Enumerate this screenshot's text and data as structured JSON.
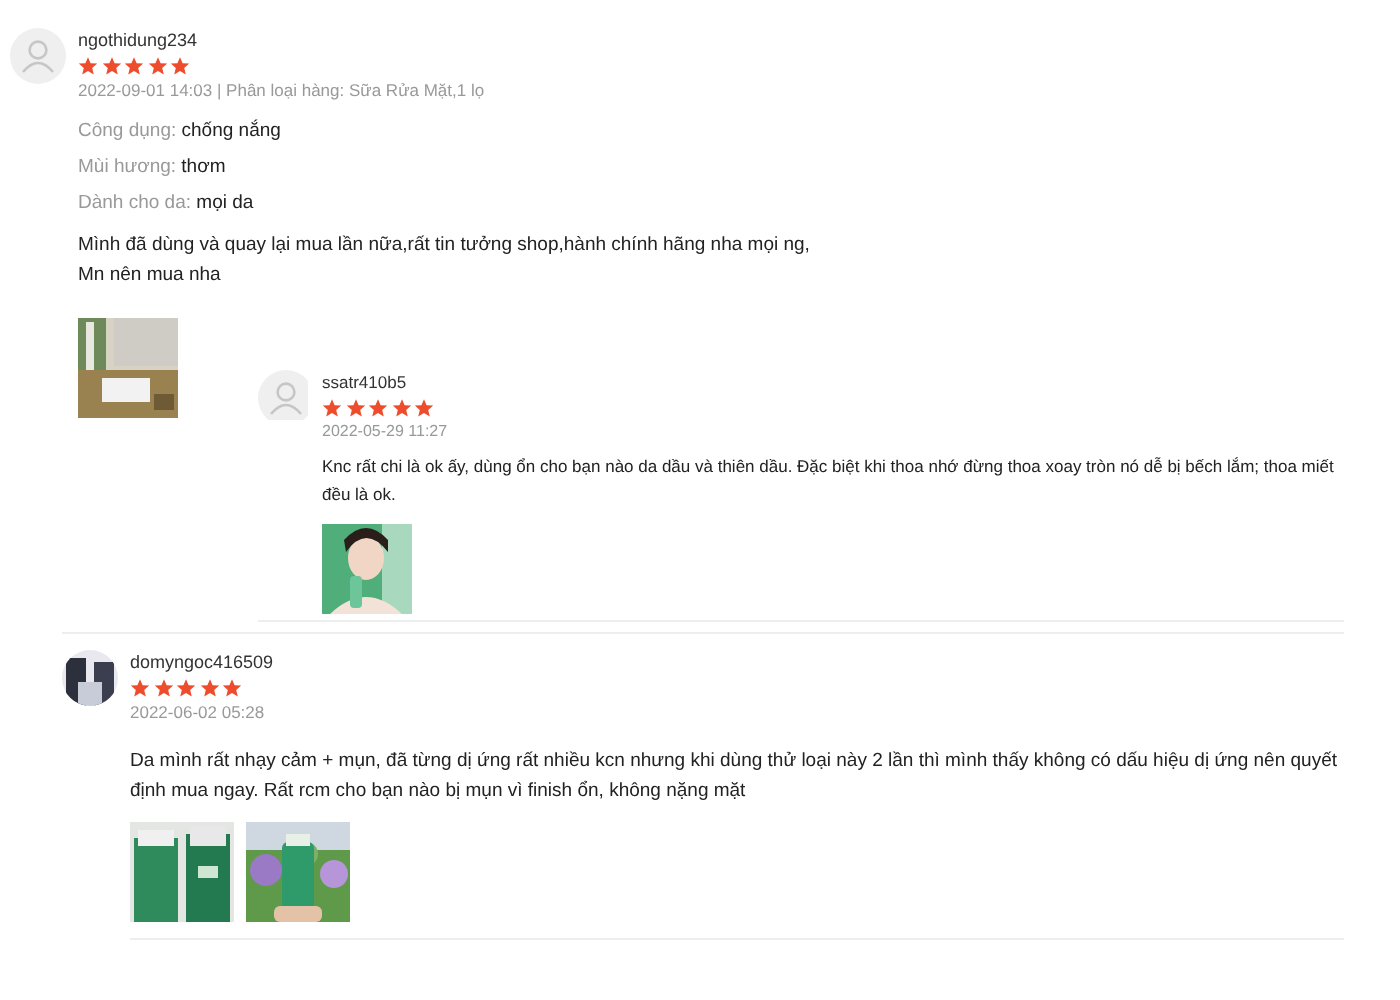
{
  "reviews": [
    {
      "user": "ngothidung234",
      "stars": 5,
      "meta": "2022-09-01 14:03 | Phân loại hàng: Sữa Rửa Mặt,1 lọ",
      "attributes": [
        {
          "label": "Công dụng:",
          "value": "chống nắng"
        },
        {
          "label": "Mùi hương:",
          "value": "thơm"
        },
        {
          "label": "Dành cho da:",
          "value": "mọi da"
        }
      ],
      "body": "Mình đã dùng và quay lại mua lần nữa,rất tin tưởng shop,hành chính hãng nha mọi ng,\nMn nên mua nha",
      "photos": [
        {
          "kind": "picture"
        }
      ],
      "children": [
        {
          "user": "ssatr410b5",
          "stars": 5,
          "meta": "2022-05-29 11:27",
          "body": "Knc rất chi là ok ấy, dùng ổn cho bạn nào da dầu và thiên dầu. Đặc biệt khi thoa nhớ đừng thoa xoay tròn nó dễ bị bếch lắm; thoa miết đều là ok.",
          "photos": [
            {
              "kind": "picture"
            }
          ]
        }
      ]
    },
    {
      "user": "domyngoc416509",
      "avatar": {
        "kind": "picture"
      },
      "stars": 5,
      "meta": "2022-06-02 05:28",
      "body": "Da mình rất nhạy cảm + mụn, đã từng dị ứng rất nhiều kcn nhưng khi dùng thử loại này 2 lần thì mình thấy không có dấu hiệu dị ứng nên quyết định mua ngay. Rất rcm cho bạn nào bị mụn vì finish ổn, không nặng mặt",
      "photos": [
        {
          "kind": "picture"
        },
        {
          "kind": "picture"
        }
      ]
    }
  ]
}
